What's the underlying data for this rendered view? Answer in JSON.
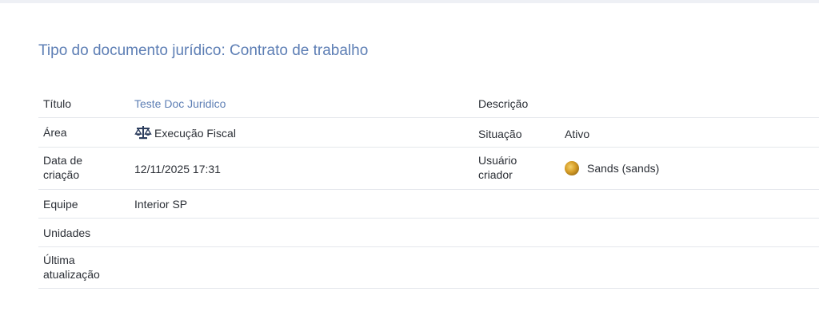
{
  "page": {
    "title": "Tipo do documento jurídico: Contrato de trabalho"
  },
  "details": {
    "titulo_label": "Título",
    "titulo_value": "Teste Doc Juridico",
    "descricao_label": "Descrição",
    "descricao_value": "",
    "area_label": "Área",
    "area_icon": "scale-icon",
    "area_value": "Execução Fiscal",
    "situacao_label": "Situação",
    "situacao_value": "Ativo",
    "data_criacao_label_1": "Data de",
    "data_criacao_label_2": "criação",
    "data_criacao_value": "12/11/2025 17:31",
    "usuario_label_1": "Usuário",
    "usuario_label_2": "criador",
    "usuario_value": "Sands (sands)",
    "equipe_label": "Equipe",
    "equipe_value": "Interior SP",
    "unidades_label": "Unidades",
    "unidades_value": "",
    "ultima_label_1": "Última",
    "ultima_label_2": "atualização",
    "ultima_value": ""
  },
  "colors": {
    "accent": "#5e7fb5",
    "icon": "#2d3e5e",
    "divider": "#e4e7ec"
  }
}
